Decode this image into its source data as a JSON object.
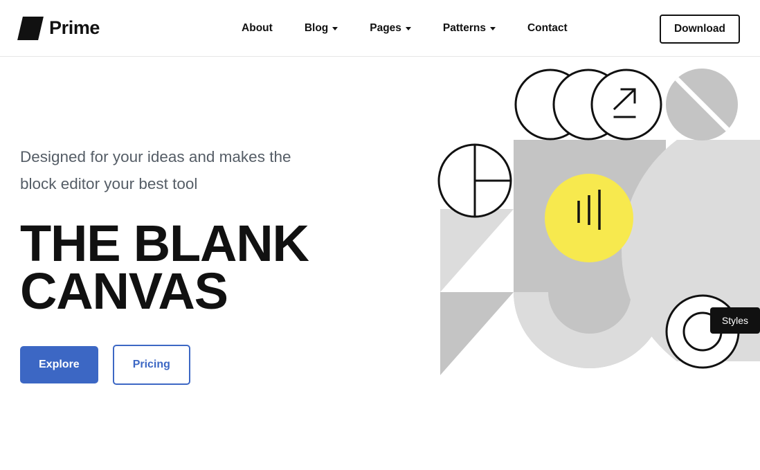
{
  "header": {
    "brand": {
      "name": "Prime",
      "mark_icon": "parallelogram-logo-icon"
    },
    "nav": [
      {
        "label": "About",
        "has_submenu": false
      },
      {
        "label": "Blog",
        "has_submenu": true
      },
      {
        "label": "Pages",
        "has_submenu": true
      },
      {
        "label": "Patterns",
        "has_submenu": true
      },
      {
        "label": "Contact",
        "has_submenu": false
      }
    ],
    "download_label": "Download"
  },
  "hero": {
    "subtitle": "Designed for your ideas and makes the block editor your best tool",
    "title": "THE BLANK CANVAS",
    "primary_button": "Explore",
    "secondary_button": "Pricing"
  },
  "tooltip": {
    "label": "Styles"
  },
  "colors": {
    "accent_blue": "#3c67c4",
    "ink": "#111111",
    "body_text": "#555d66",
    "yellow": "#f7e94e",
    "gray_mid": "#c4c4c4",
    "gray_light": "#dcdcdc",
    "border": "#e6e6e6"
  },
  "graphic": {
    "shapes": [
      "overlapping-circles-trio",
      "arrow-up-right-icon",
      "gray-circle-with-diagonal-stripe",
      "pie-chart-circle",
      "gray-square",
      "yellow-circle-with-bars",
      "bar-chart-icon",
      "light-triangle",
      "medium-triangle",
      "light-gray-arch",
      "light-gray-half-donut",
      "concentric-circles"
    ]
  }
}
